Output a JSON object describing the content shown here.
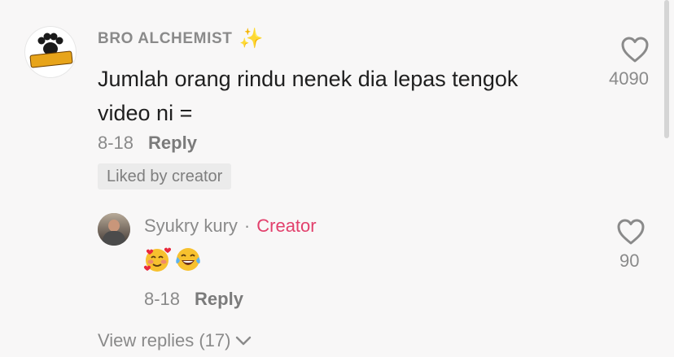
{
  "comment": {
    "username": "BRO ALCHEMIST",
    "text_line1": "Jumlah orang rindu nenek dia lepas tengok",
    "text_line2": "video ni =",
    "date": "8-18",
    "reply_label": "Reply",
    "liked_badge": "Liked by creator",
    "like_count": "4090"
  },
  "reply_comment": {
    "username": "Syukry kury",
    "separator": "·",
    "creator_tag": "Creator",
    "date": "8-18",
    "reply_label": "Reply",
    "like_count": "90"
  },
  "view_replies": "View replies (17)",
  "colors": {
    "background": "#f8f7f7",
    "muted_text": "#8a8a8a",
    "creator_accent": "#e2406c"
  },
  "icons": {
    "heart": "heart-icon",
    "sparkles": "sparkles-icon",
    "chevron": "chevron-down-icon"
  }
}
